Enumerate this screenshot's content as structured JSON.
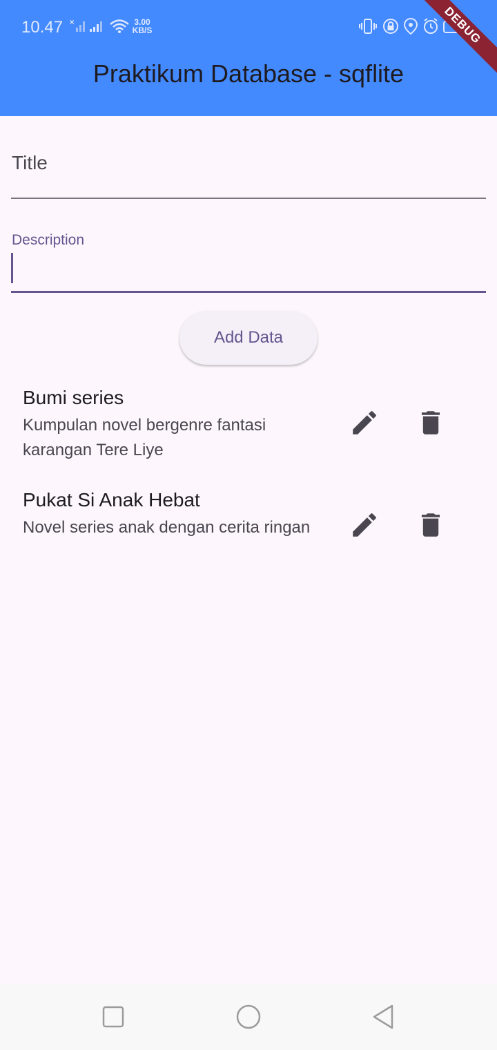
{
  "status_bar": {
    "time": "10.47",
    "net_speed_value": "3.00",
    "net_speed_unit": "KB/S"
  },
  "debug_banner": "DEBUG",
  "app_bar": {
    "title": "Praktikum Database - sqflite"
  },
  "form": {
    "title_field": {
      "label": "Title",
      "value": ""
    },
    "description_field": {
      "label": "Description",
      "value": ""
    },
    "add_button_label": "Add Data"
  },
  "items": [
    {
      "title": "Bumi series",
      "description": "Kumpulan novel bergenre fantasi karangan Tere Liye"
    },
    {
      "title": "Pukat Si Anak Hebat",
      "description": "Novel series anak dengan cerita ringan"
    }
  ],
  "colors": {
    "app_bar": "#448aff",
    "background": "#fdf7fd",
    "accent": "#65558f",
    "debug_ribbon": "#8b2333"
  },
  "icons": {
    "edit": "pencil-icon",
    "delete": "trash-icon",
    "nav_recent": "square-icon",
    "nav_home": "circle-icon",
    "nav_back": "triangle-back-icon"
  }
}
